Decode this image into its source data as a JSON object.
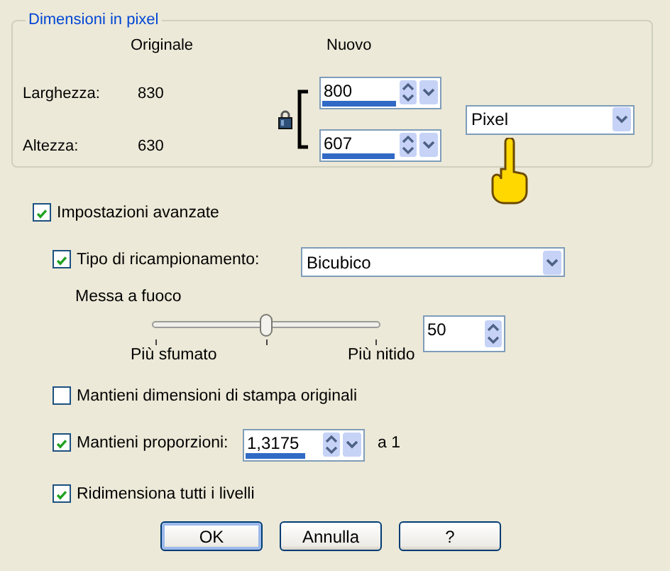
{
  "group": {
    "title": "Dimensioni in pixel",
    "header_original": "Originale",
    "header_new": "Nuovo",
    "linked": true,
    "unit": "Pixel",
    "rows": [
      {
        "label": "Larghezza:",
        "original": "830",
        "new": "800",
        "level": 0.64
      },
      {
        "label": "Altezza:",
        "original": "630",
        "new": "607",
        "level": 0.62
      }
    ]
  },
  "advanced": {
    "label": "Impostazioni avanzate",
    "checked": true
  },
  "resample": {
    "label": "Tipo di ricampionamento:",
    "checked": true,
    "value": "Bicubico"
  },
  "sharpness": {
    "label": "Messa a fuoco",
    "level": 0.5,
    "min_label": "Più sfumato",
    "max_label": "Più nitido",
    "value": "50"
  },
  "keep_print": {
    "label": "Mantieni dimensioni di stampa originali",
    "checked": false
  },
  "aspect": {
    "label": "Mantieni proporzioni:",
    "checked": true,
    "value": "1,3175",
    "level": 0.51,
    "suffix": "a 1"
  },
  "resize_all": {
    "label": "Ridimensiona tutti i livelli",
    "checked": true
  },
  "buttons": [
    {
      "label": "OK",
      "default": true
    },
    {
      "label": "Annulla",
      "default": false
    },
    {
      "label": "?",
      "default": false
    }
  ]
}
